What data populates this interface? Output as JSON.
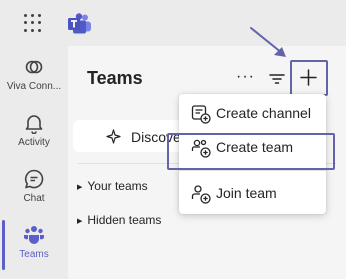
{
  "colors": {
    "accent": "#5b5fc7",
    "highlight": "#6264a7",
    "rail_bg": "#ebebeb",
    "panel_bg": "#f5f5f5"
  },
  "app_bar": {
    "launcher_icon": "waffle-icon",
    "logo_icon": "teams-logo-icon"
  },
  "rail": {
    "items": [
      {
        "label": "Viva Conn...",
        "icon": "viva-connections-icon"
      },
      {
        "label": "Activity",
        "icon": "bell-icon"
      },
      {
        "label": "Chat",
        "icon": "chat-icon"
      },
      {
        "label": "Teams",
        "icon": "teams-icon",
        "active": true
      }
    ]
  },
  "panel": {
    "title": "Teams",
    "more_label": "···",
    "discover_label": "Discove",
    "groups": [
      {
        "label": "Your teams"
      },
      {
        "label": "Hidden teams"
      }
    ]
  },
  "menu": {
    "items": [
      {
        "label": "Create channel",
        "icon": "create-channel-icon"
      },
      {
        "label": "Create team",
        "icon": "create-team-icon",
        "highlighted": true
      },
      {
        "label": "Join team",
        "icon": "join-team-icon"
      }
    ]
  }
}
